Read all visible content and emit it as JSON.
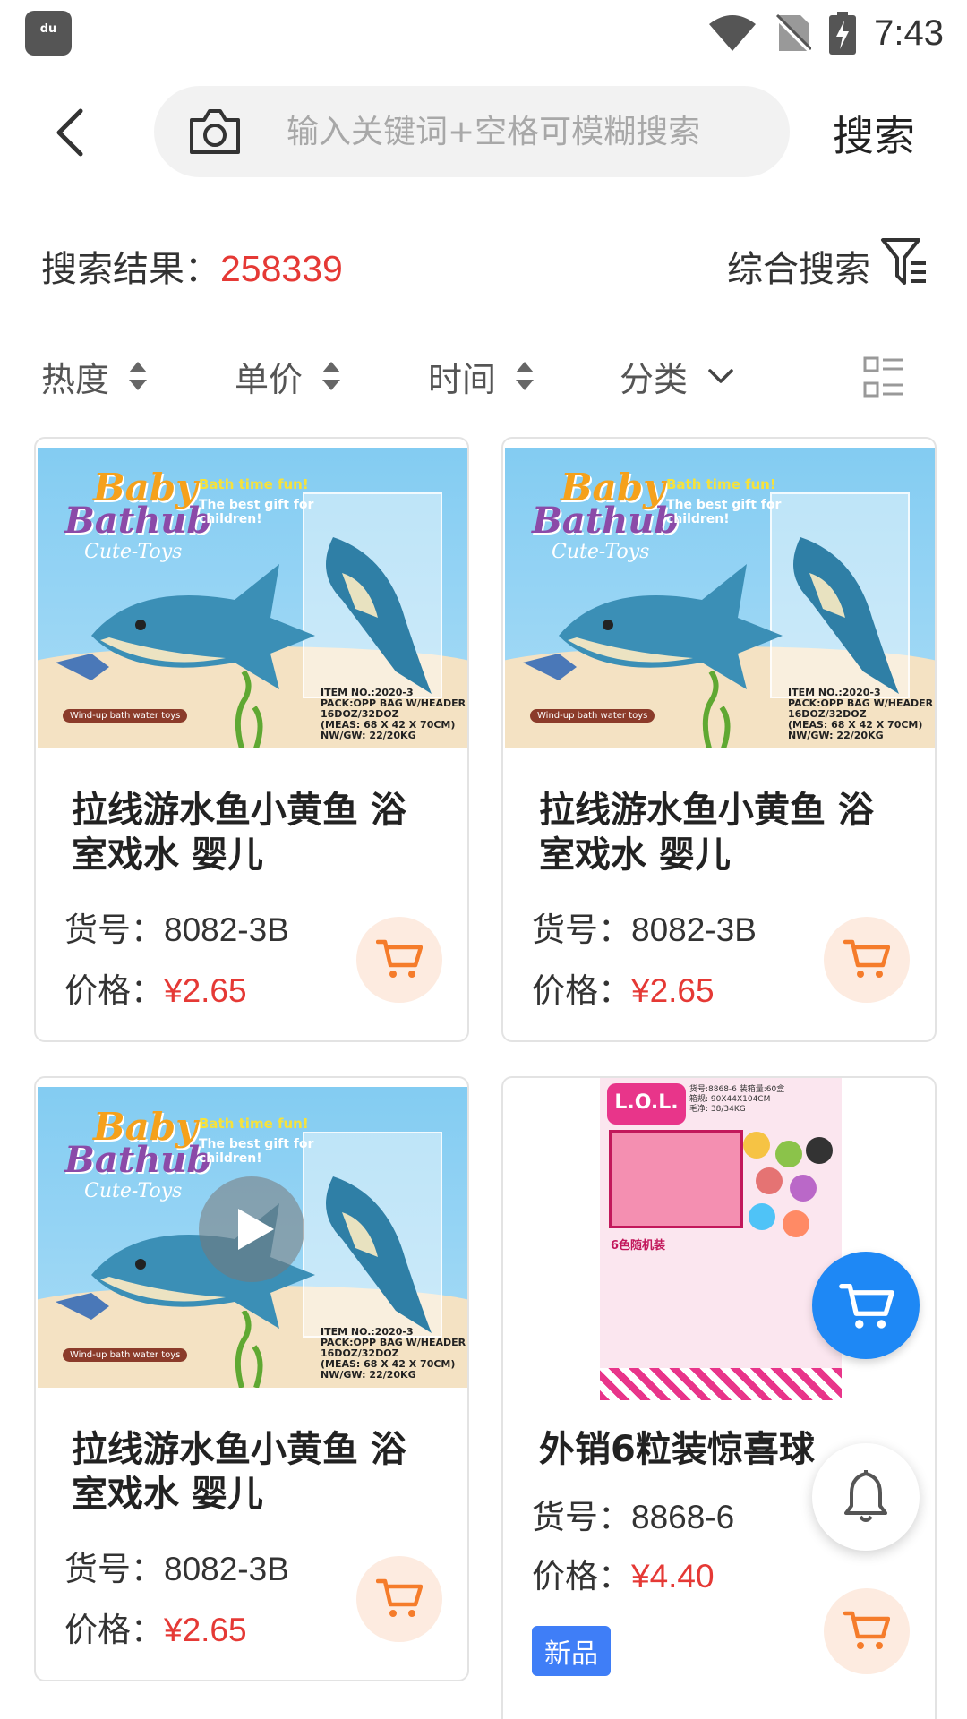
{
  "status_bar": {
    "app_icon_label": "du",
    "time": "7:43",
    "icons": [
      "wifi-icon",
      "no-sim-icon",
      "battery-charging-icon"
    ]
  },
  "search": {
    "back_icon": "back-arrow-icon",
    "camera_icon": "camera-icon",
    "placeholder": "输入关键词+空格可模糊搜索",
    "value": "",
    "button_label": "搜索"
  },
  "results": {
    "label": "搜索结果：",
    "count": "258339",
    "sort_mode": "综合搜索",
    "filter_icon": "filter-icon"
  },
  "sort_tabs": [
    {
      "label": "热度",
      "icon": "sort-arrows-icon"
    },
    {
      "label": "单价",
      "icon": "sort-arrows-icon"
    },
    {
      "label": "时间",
      "icon": "sort-arrows-icon"
    },
    {
      "label": "分类",
      "icon": "chevron-down-icon"
    }
  ],
  "layout_toggle_icon": "list-layout-icon",
  "accent_colors": {
    "price": "#e53935",
    "cart_bg": "#fdebe0",
    "cart_icon": "#f57c2b",
    "fab": "#1e88f5",
    "new_badge": "#3f7ef7"
  },
  "product_image_text": {
    "logo_line1": "Baby",
    "logo_line2": "Bathub",
    "logo_line3": "Cute-Toys",
    "tag1": "Bath time fun!",
    "tag2a": "The best gift for",
    "tag2b": "children!",
    "item_no": "ITEM NO.:2020-3",
    "pack": "PACK:OPP BAG W/HEADER",
    "qty": "16DOZ/32DOZ",
    "meas": "(MEAS: 68 X 42 X 70CM)",
    "weight": "NW/GW: 22/20KG",
    "badge": "Wind-up bath water toys",
    "lol_logo": "L.O.L.",
    "lol_meta1": "货号:8868-6  装箱量:60盒",
    "lol_meta2": "箱规: 90X44X104CM",
    "lol_meta3": "毛净: 38/34KG",
    "lol_label": "6色随机装"
  },
  "products": [
    {
      "title_line1": "拉线游水鱼小黄鱼 浴",
      "title_line2": "室戏水 婴儿",
      "sku_label": "货号：",
      "sku": "8082-3B",
      "price_label": "价格：",
      "price": "¥2.65"
    },
    {
      "title_line1": "拉线游水鱼小黄鱼 浴",
      "title_line2": "室戏水 婴儿",
      "sku_label": "货号：",
      "sku": "8082-3B",
      "price_label": "价格：",
      "price": "¥2.65"
    },
    {
      "title_line1": "拉线游水鱼小黄鱼 浴",
      "title_line2": "室戏水 婴儿",
      "sku_label": "货号：",
      "sku": "8082-3B",
      "price_label": "价格：",
      "price": "¥2.65"
    },
    {
      "title_line1": "外销6粒装惊喜球",
      "title_line2": "",
      "sku_label": "货号：",
      "sku": "8868-6",
      "price_label": "价格：",
      "price": "¥4.40",
      "badge": "新品"
    }
  ],
  "floating": {
    "cart_icon": "cart-icon",
    "bell_icon": "bell-icon"
  }
}
